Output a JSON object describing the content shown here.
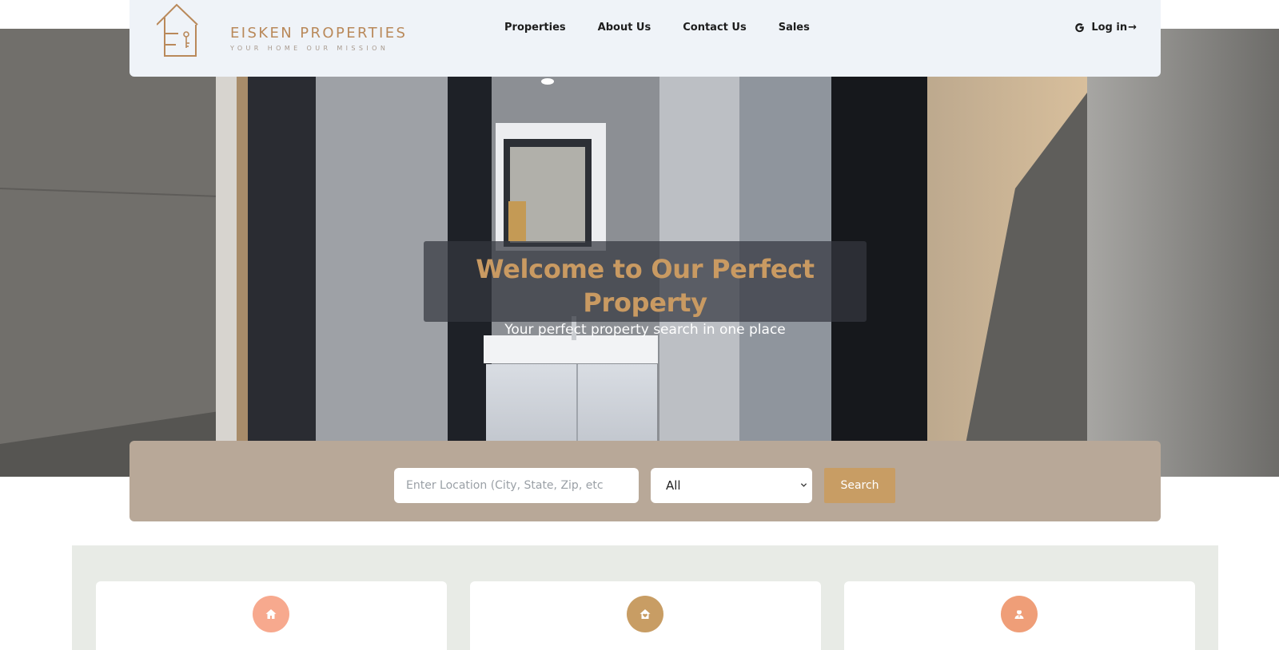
{
  "brand": {
    "name": "EISKEN PROPERTIES",
    "tagline": "YOUR HOME OUR MISSION"
  },
  "nav": {
    "items": [
      {
        "label": "Properties"
      },
      {
        "label": "About Us"
      },
      {
        "label": "Contact Us"
      },
      {
        "label": "Sales"
      }
    ],
    "login_label": "Log in",
    "login_arrow": "→",
    "login_icon": "google-g-icon"
  },
  "hero": {
    "title": "Welcome to Our Perfect Property",
    "subtitle": "Your perfect property search in one place"
  },
  "search": {
    "location_placeholder": "Enter Location (City, State, Zip, etc",
    "location_value": "",
    "type_selected": "All",
    "button_label": "Search"
  },
  "features": {
    "cards": [
      {
        "icon": "home-icon",
        "color": "#f7a98e"
      },
      {
        "icon": "house-heart-icon",
        "color": "#c89d64"
      },
      {
        "icon": "agent-user-icon",
        "color": "#ef9e78"
      }
    ]
  },
  "colors": {
    "accent": "#c89d64",
    "navbar_bg": "#eff3f8",
    "search_bar_bg": "#b8a898",
    "features_bg": "#e8ebe6",
    "hero_title": "#c99a62"
  }
}
